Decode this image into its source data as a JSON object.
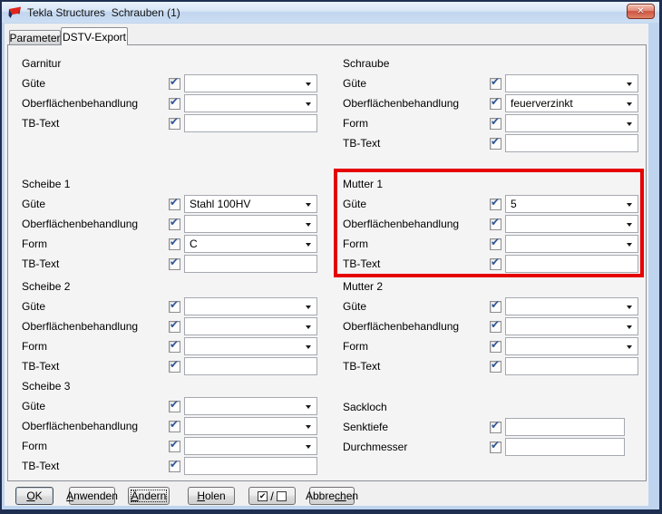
{
  "colors": {
    "highlight_red": "#e60000",
    "check_blue": "#2f5596"
  },
  "window": {
    "title": "Tekla Structures  Schrauben (1)"
  },
  "icons": {
    "check": "✔",
    "close": "✕"
  },
  "tabs": {
    "parameter": "Parameter",
    "dstv_export": "DSTV-Export",
    "active_tab": "DSTV-Export"
  },
  "sections": {
    "garnitur": {
      "title": "Garnitur",
      "rows": [
        {
          "id": "guete",
          "label": "Güte",
          "type": "combo",
          "value": "",
          "checked": true
        },
        {
          "id": "oberflaechenbehandlung",
          "label": "Oberflächenbehandlung",
          "type": "combo",
          "value": "",
          "checked": true
        },
        {
          "id": "tb-text",
          "label": "TB-Text",
          "type": "text",
          "value": "",
          "checked": true
        }
      ]
    },
    "scheibe1": {
      "title": "Scheibe 1",
      "rows": [
        {
          "id": "guete",
          "label": "Güte",
          "type": "combo",
          "value": "Stahl 100HV",
          "checked": true
        },
        {
          "id": "oberflaechenbehandlung",
          "label": "Oberflächenbehandlung",
          "type": "combo",
          "value": "",
          "checked": true
        },
        {
          "id": "form",
          "label": "Form",
          "type": "combo",
          "value": "C",
          "checked": true
        },
        {
          "id": "tb-text",
          "label": "TB-Text",
          "type": "text",
          "value": "",
          "checked": true
        }
      ]
    },
    "scheibe2": {
      "title": "Scheibe 2",
      "rows": [
        {
          "id": "guete",
          "label": "Güte",
          "type": "combo",
          "value": "",
          "checked": true
        },
        {
          "id": "oberflaechenbehandlung",
          "label": "Oberflächenbehandlung",
          "type": "combo",
          "value": "",
          "checked": true
        },
        {
          "id": "form",
          "label": "Form",
          "type": "combo",
          "value": "",
          "checked": true
        },
        {
          "id": "tb-text",
          "label": "TB-Text",
          "type": "text",
          "value": "",
          "checked": true
        }
      ]
    },
    "scheibe3": {
      "title": "Scheibe 3",
      "rows": [
        {
          "id": "guete",
          "label": "Güte",
          "type": "combo",
          "value": "",
          "checked": true
        },
        {
          "id": "oberflaechenbehandlung",
          "label": "Oberflächenbehandlung",
          "type": "combo",
          "value": "",
          "checked": true
        },
        {
          "id": "form",
          "label": "Form",
          "type": "combo",
          "value": "",
          "checked": true
        },
        {
          "id": "tb-text",
          "label": "TB-Text",
          "type": "text",
          "value": "",
          "checked": true
        }
      ]
    },
    "schraube": {
      "title": "Schraube",
      "rows": [
        {
          "id": "guete",
          "label": "Güte",
          "type": "combo",
          "value": "",
          "checked": true
        },
        {
          "id": "oberflaechenbehandlung",
          "label": "Oberflächenbehandlung",
          "type": "combo",
          "value": "feuerverzinkt",
          "checked": true
        },
        {
          "id": "form",
          "label": "Form",
          "type": "combo",
          "value": "",
          "checked": true
        },
        {
          "id": "tb-text",
          "label": "TB-Text",
          "type": "text",
          "value": "",
          "checked": true
        }
      ]
    },
    "mutter1": {
      "title": "Mutter 1",
      "highlighted": true,
      "rows": [
        {
          "id": "guete",
          "label": "Güte",
          "type": "combo",
          "value": "5",
          "checked": true
        },
        {
          "id": "oberflaechenbehandlung",
          "label": "Oberflächenbehandlung",
          "type": "combo",
          "value": "",
          "checked": true
        },
        {
          "id": "form",
          "label": "Form",
          "type": "combo",
          "value": "",
          "checked": true
        },
        {
          "id": "tb-text",
          "label": "TB-Text",
          "type": "text",
          "value": "",
          "checked": true
        }
      ]
    },
    "mutter2": {
      "title": "Mutter 2",
      "rows": [
        {
          "id": "guete",
          "label": "Güte",
          "type": "combo",
          "value": "",
          "checked": true
        },
        {
          "id": "oberflaechenbehandlung",
          "label": "Oberflächenbehandlung",
          "type": "combo",
          "value": "",
          "checked": true
        },
        {
          "id": "form",
          "label": "Form",
          "type": "combo",
          "value": "",
          "checked": true
        },
        {
          "id": "tb-text",
          "label": "TB-Text",
          "type": "text",
          "value": "",
          "checked": true
        }
      ]
    },
    "sackloch": {
      "title": "Sackloch",
      "rows": [
        {
          "id": "senktiefe",
          "label": "Senktiefe",
          "type": "text",
          "value": "",
          "checked": true
        },
        {
          "id": "durchmesser",
          "label": "Durchmesser",
          "type": "text",
          "value": "",
          "checked": true
        }
      ]
    }
  },
  "footer": {
    "ok": {
      "pre": "",
      "key": "O",
      "post": "K"
    },
    "anwenden": {
      "pre": "",
      "key": "A",
      "post": "nwenden"
    },
    "aendern": {
      "pre": "",
      "key": "Ä",
      "post": "ndern"
    },
    "holen": {
      "pre": "",
      "key": "H",
      "post": "olen"
    },
    "toggle": {
      "check": "✔",
      "separator": "/"
    },
    "abbrechen": {
      "pre": "Abbre",
      "key": "ch",
      "post": "en"
    }
  }
}
